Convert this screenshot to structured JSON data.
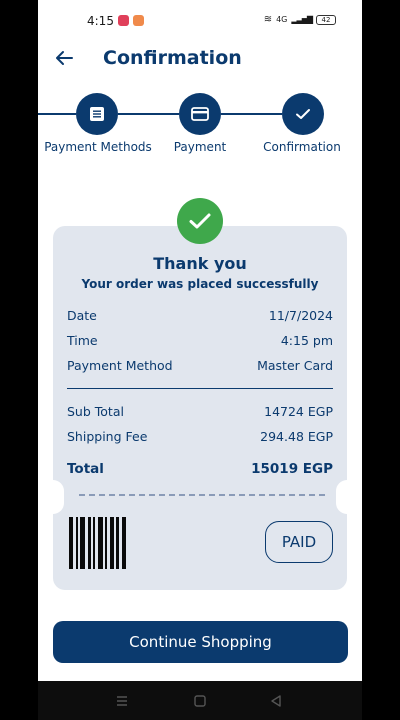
{
  "status_bar": {
    "time": "4:15",
    "wifi_label": "≋",
    "network_label": "4G",
    "signal_label": "▂▃▅▇",
    "battery": "42"
  },
  "header": {
    "title": "Confirmation"
  },
  "stepper": {
    "steps": [
      {
        "label": "Payment Methods",
        "icon": "list-icon"
      },
      {
        "label": "Payment",
        "icon": "card-icon"
      },
      {
        "label": "Confirmation",
        "icon": "check-icon"
      }
    ]
  },
  "receipt": {
    "title": "Thank you",
    "subtitle": "Your order was placed successfully",
    "details": [
      {
        "label": "Date",
        "value": "11/7/2024"
      },
      {
        "label": "Time",
        "value": "4:15 pm"
      },
      {
        "label": "Payment Method",
        "value": "Master Card"
      }
    ],
    "summary": [
      {
        "label": "Sub Total",
        "value": "14724 EGP"
      },
      {
        "label": "Shipping Fee",
        "value": "294.48 EGP"
      }
    ],
    "total": {
      "label": "Total",
      "value": "15019 EGP"
    },
    "paid_label": "PAID"
  },
  "actions": {
    "continue_label": "Continue Shopping"
  },
  "colors": {
    "primary": "#0b3a6e",
    "success": "#3fa84b",
    "card_bg": "#e1e6ee"
  }
}
